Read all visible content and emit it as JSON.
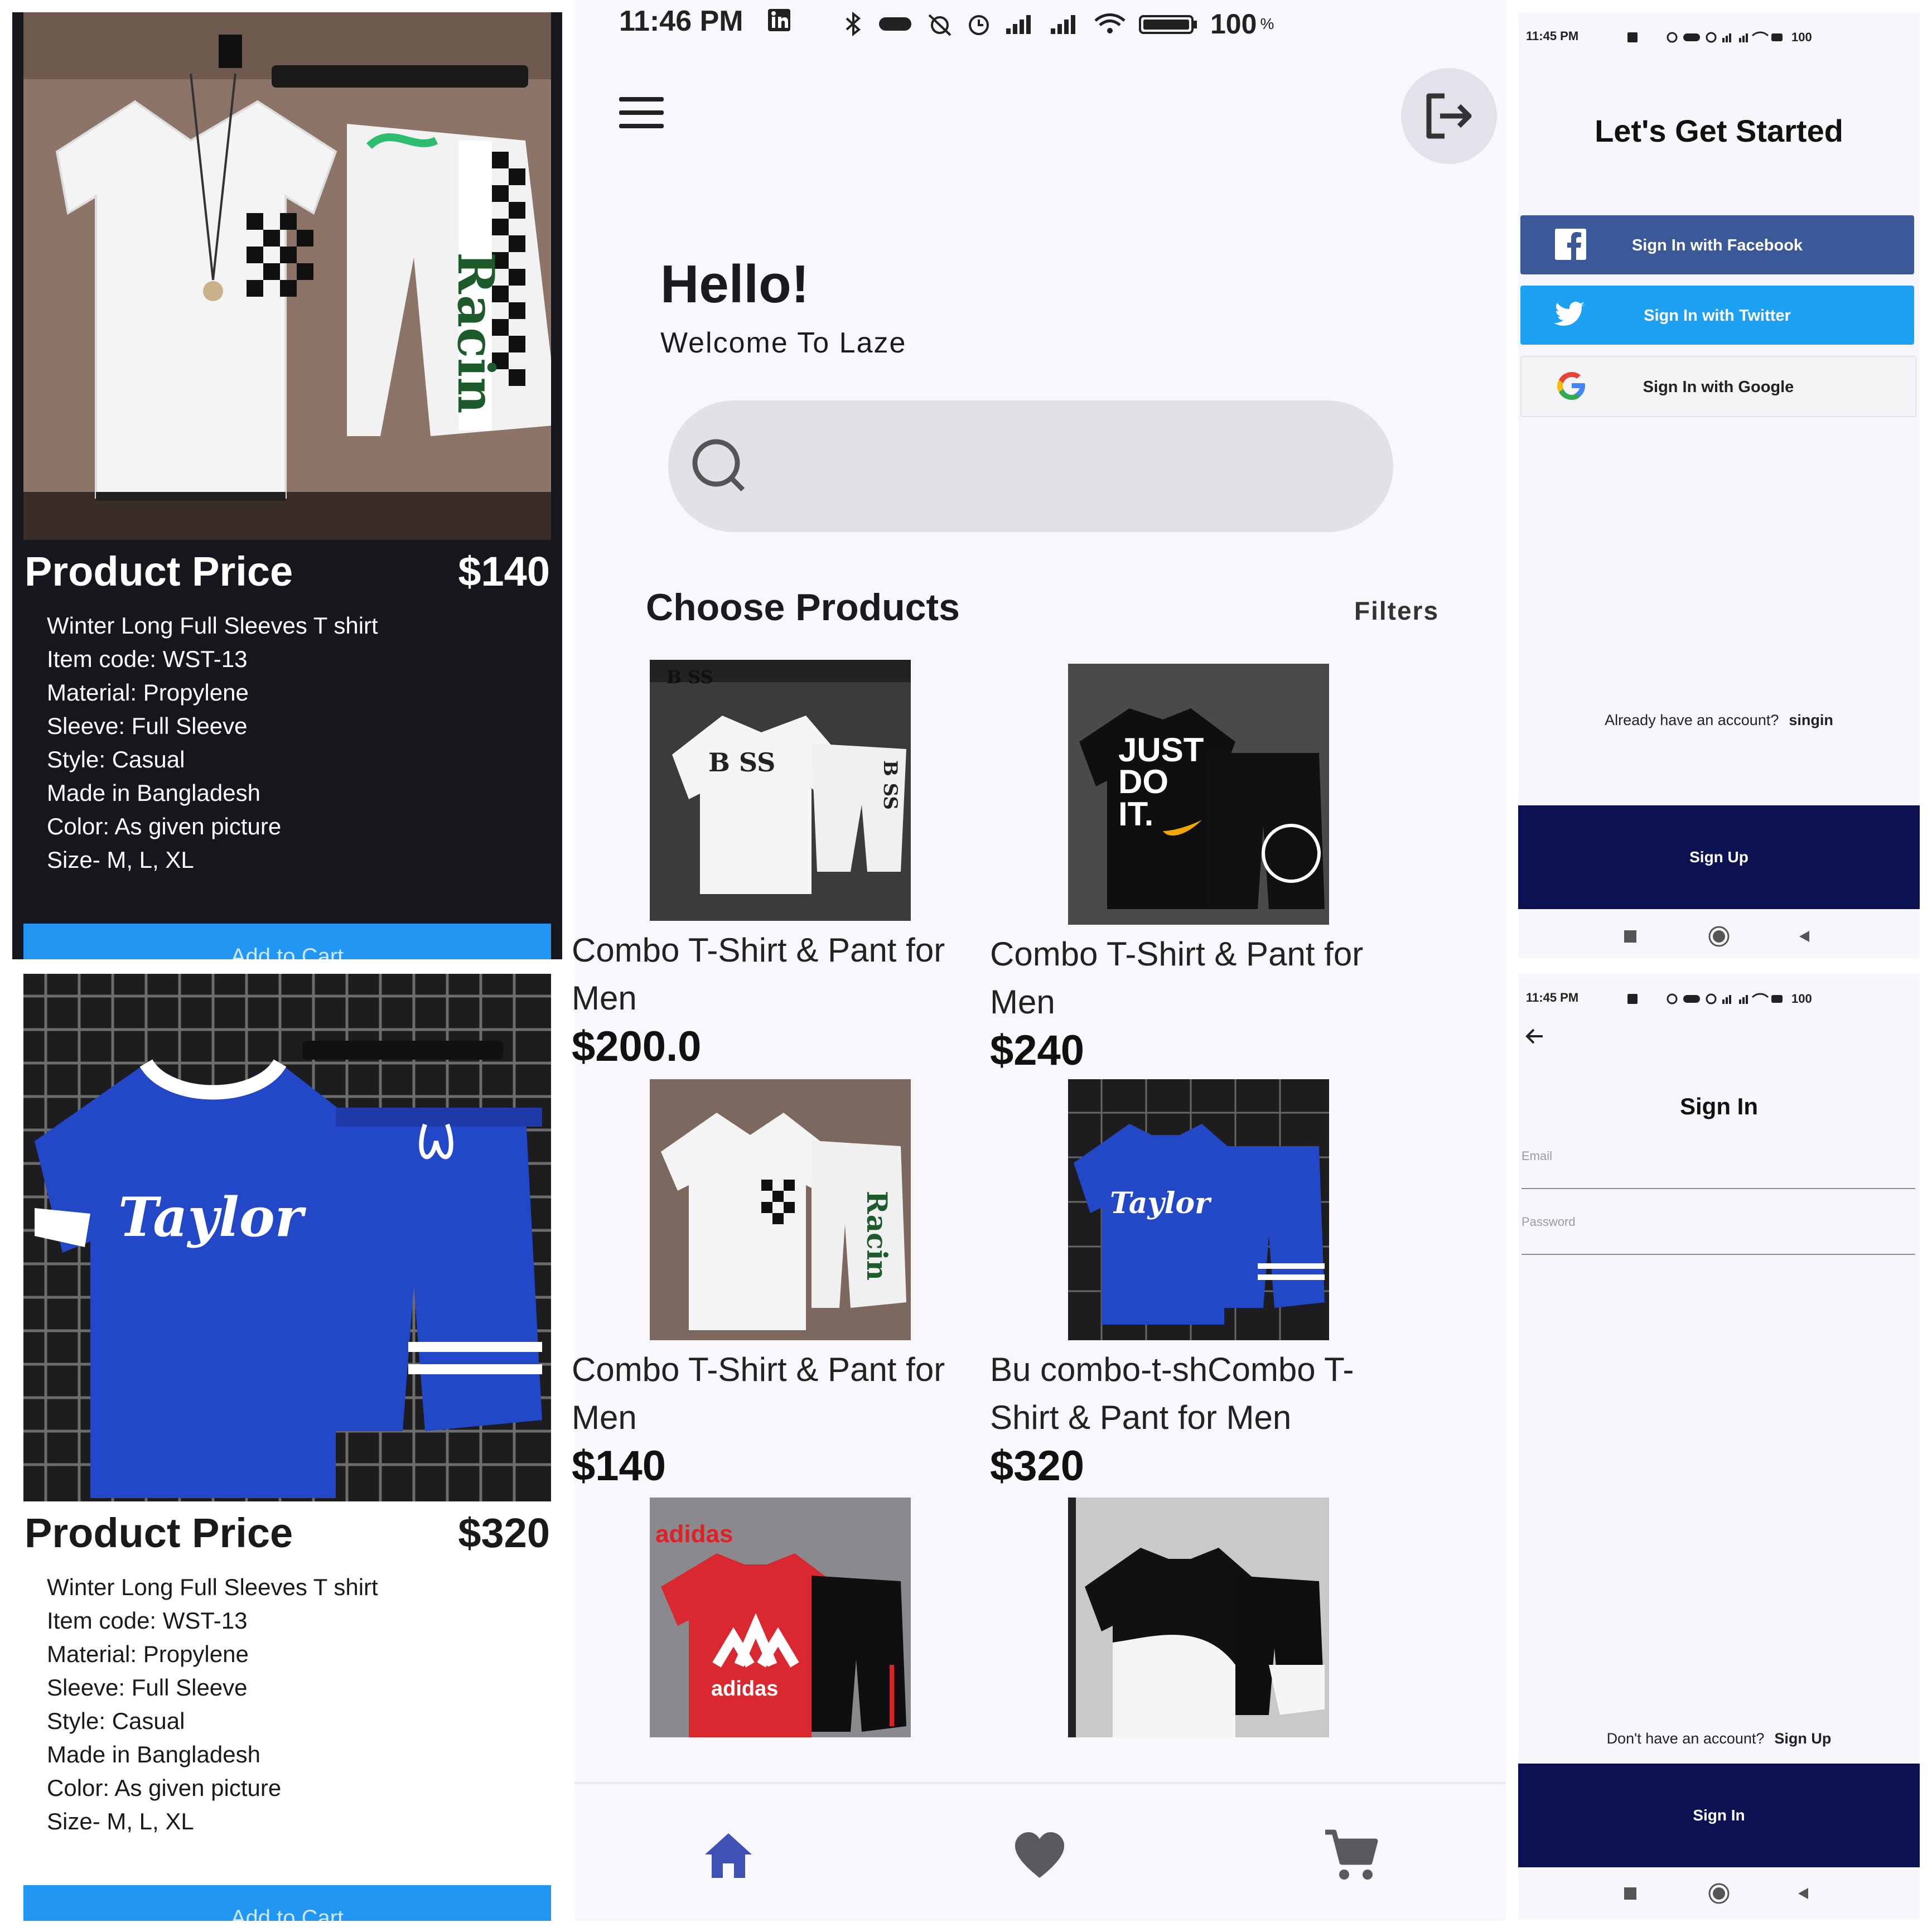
{
  "detail_panels": [
    {
      "price_label": "Product Price",
      "price": "$140",
      "specs": [
        "Winter Long Full Sleeves T shirt",
        "Item code: WST-13",
        "Material: Propylene",
        "Sleeve: Full Sleeve",
        "Style: Casual",
        "Made in Bangladesh",
        "Color: As given picture",
        "Size- M, L, XL"
      ],
      "button": "Add to Cart"
    },
    {
      "price_label": "Product Price",
      "price": "$320",
      "specs": [
        "Winter Long Full Sleeves T shirt",
        "Item code: WST-13",
        "Material: Propylene",
        "Sleeve: Full Sleeve",
        "Style: Casual",
        "Made in Bangladesh",
        "Color: As given picture",
        "Size- M, L, XL"
      ],
      "button": "Add to Cart"
    }
  ],
  "home": {
    "status_time": "11:46 PM",
    "battery": "100",
    "battery_unit": "%",
    "greeting": "Hello!",
    "welcome": "Welcome To Laze",
    "section_title": "Choose Products",
    "filters": "Filters",
    "products": [
      {
        "name": "Combo T-Shirt & Pant for Men",
        "price": "$200.0",
        "image": "white-boss-tshirt-shorts-set"
      },
      {
        "name": "Combo T-Shirt & Pant for Men",
        "price": "$240",
        "image": "black-just-do-it-tshirt-shorts-set"
      },
      {
        "name": "Combo T-Shirt & Pant for Men",
        "price": "$140",
        "image": "white-checkered-tshirt-shorts-set"
      },
      {
        "name": "Bu combo-t-shCombo T-Shirt & Pant for Men",
        "price": "$320",
        "image": "blue-taylor-tshirt-shorts-set"
      },
      {
        "name": "",
        "price": "",
        "image": "red-adidas-tshirt-shorts-set"
      },
      {
        "name": "",
        "price": "",
        "image": "black-white-tshirt-shorts-set"
      }
    ],
    "nav": [
      "home-icon",
      "heart-icon",
      "cart-icon"
    ]
  },
  "signup": {
    "status_time": "11:45 PM",
    "battery": "100",
    "title": "Let's Get Started",
    "facebook": "Sign In with Facebook",
    "twitter": "Sign In with Twitter",
    "google": "Sign In with Google",
    "already_text": "Already have an account?",
    "already_link": "singin",
    "button": "Sign Up"
  },
  "signin": {
    "status_time": "11:45 PM",
    "battery": "100",
    "title": "Sign In",
    "email_label": "Email",
    "password_label": "Password",
    "no_account_text": "Don't have an account?",
    "no_account_link": "Sign Up",
    "button": "Sign In"
  },
  "colors": {
    "facebook": "#3b5998",
    "twitter": "#1da1f2",
    "primary": "#0c1251",
    "cart_button": "#2196f3",
    "nav_home": "#3f51b5"
  }
}
